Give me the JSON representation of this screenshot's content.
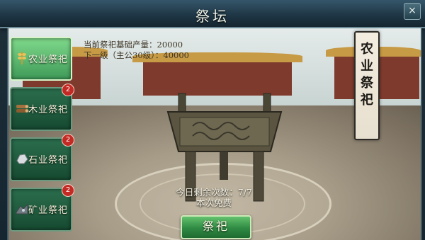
{
  "window": {
    "title": "祭坛",
    "close_label": "×"
  },
  "tabs": [
    {
      "label": "农业祭祀",
      "active": true,
      "badge": "",
      "icon": "wheat-icon"
    },
    {
      "label": "木业祭祀",
      "active": false,
      "badge": "2",
      "icon": "logs-icon"
    },
    {
      "label": "石业祭祀",
      "active": false,
      "badge": "2",
      "icon": "stone-icon"
    },
    {
      "label": "矿业祭祀",
      "active": false,
      "badge": "2",
      "icon": "ore-icon"
    }
  ],
  "info": {
    "base_output_label": "当前祭祀基础产量：",
    "base_output_value": "20000",
    "next_level_label": "下一级（主公30级）：",
    "next_level_value": "40000"
  },
  "banner": {
    "text": "农业祭祀"
  },
  "counts": {
    "remaining": "今日剩余次数：7/7",
    "cost": "本次免费"
  },
  "action": {
    "label": "祭祀"
  },
  "colors": {
    "tab_active": "#7fd98b",
    "tab_inactive": "#2b6e4d",
    "badge": "#c42a24"
  }
}
